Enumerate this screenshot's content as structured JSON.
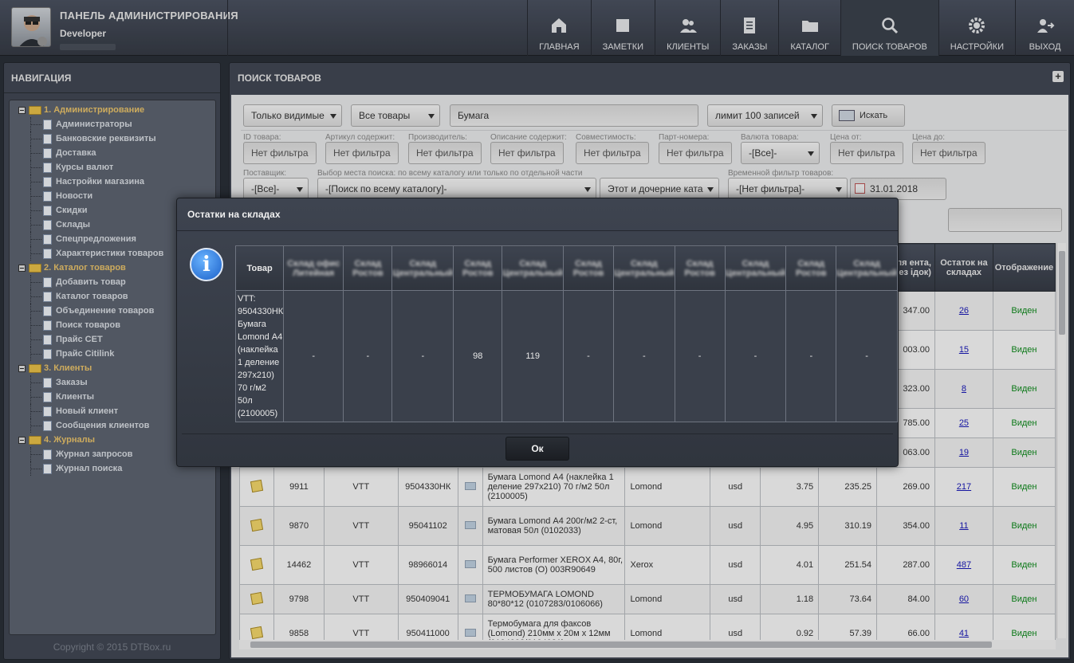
{
  "header": {
    "title": "ПАНЕЛЬ АДМИНИСТРИРОВАНИЯ",
    "user": "Developer",
    "nav": [
      {
        "label": "ГЛАВНАЯ",
        "icon": "home-icon"
      },
      {
        "label": "ЗАМЕТКИ",
        "icon": "notes-icon"
      },
      {
        "label": "КЛИЕНТЫ",
        "icon": "clients-icon"
      },
      {
        "label": "ЗАКАЗЫ",
        "icon": "orders-icon"
      },
      {
        "label": "КАТАЛОГ",
        "icon": "folder-icon"
      },
      {
        "label": "ПОИСК ТОВАРОВ",
        "icon": "search-icon"
      },
      {
        "label": "НАСТРОЙКИ",
        "icon": "gear-icon"
      },
      {
        "label": "ВЫХОД",
        "icon": "logout-icon"
      }
    ]
  },
  "sidebar": {
    "title": "НАВИГАЦИЯ",
    "copyright": "Copyright © 2015 DTBox.ru",
    "groups": [
      {
        "label": "1. Администрирование",
        "items": [
          "Администраторы",
          "Банковские реквизиты",
          "Доставка",
          "Курсы валют",
          "Настройки магазина",
          "Новости",
          "Скидки",
          "Склады",
          "Спецпредложения",
          "Характеристики товаров"
        ]
      },
      {
        "label": "2. Каталог товаров",
        "items": [
          "Добавить товар",
          "Каталог товаров",
          "Объединение товаров",
          "Поиск товаров",
          "Прайс CET",
          "Прайс Citilink"
        ]
      },
      {
        "label": "3. Клиенты",
        "items": [
          "Заказы",
          "Клиенты",
          "Новый клиент",
          "Сообщения клиентов"
        ]
      },
      {
        "label": "4. Журналы",
        "items": [
          "Журнал запросов",
          "Журнал поиска"
        ]
      }
    ]
  },
  "main": {
    "title": "ПОИСК ТОВАРОВ",
    "plus": "+",
    "visibility_select": "Только видимые",
    "scope_select": "Все товары",
    "query": "Бумага",
    "limit_select": "лимит 100 записей",
    "search_button": "Искать",
    "filters": [
      {
        "label": "ID товара:",
        "value": "Нет фильтра"
      },
      {
        "label": "Артикул содержит:",
        "value": "Нет фильтра"
      },
      {
        "label": "Производитель:",
        "value": "Нет фильтра"
      },
      {
        "label": "Описание содержит:",
        "value": "Нет фильтра"
      },
      {
        "label": "Совместимость:",
        "value": "Нет фильтра"
      },
      {
        "label": "Парт-номера:",
        "value": "Нет фильтра"
      },
      {
        "label": "Валюта товара:",
        "value": "-[Все]-"
      },
      {
        "label": "Цена от:",
        "value": "Нет фильтра"
      },
      {
        "label": "Цена до:",
        "value": "Нет фильтра"
      }
    ],
    "supplier_label": "Поставщик:",
    "supplier_value": "-[Все]-",
    "place_label": "Выбор места поиска: по всему каталогу или только по отдельной части",
    "place_value": "-[Поиск по всему каталогу]-",
    "children_value": "Этот и дочерние ката",
    "time_label": "Временной фильтр товаров:",
    "time_value": "-[Нет фильтра]-",
    "date_value": "31.01.2018",
    "columns": {
      "price_client": "на для ента, б (без ідок)",
      "stock": "Остаток на складах",
      "display": "Отображение"
    },
    "rows": [
      {
        "id": "",
        "supplier": "",
        "article": "",
        "name": "",
        "maker": "",
        "cur": "",
        "p1": "",
        "p2": "",
        "p3": "347.00",
        "stock": "26",
        "display": "Виден"
      },
      {
        "id": "",
        "supplier": "",
        "article": "",
        "name": "",
        "maker": "",
        "cur": "",
        "p1": "",
        "p2": "",
        "p3": "003.00",
        "stock": "15",
        "display": "Виден"
      },
      {
        "id": "",
        "supplier": "",
        "article": "",
        "name": "",
        "maker": "",
        "cur": "",
        "p1": "",
        "p2": "",
        "p3": "323.00",
        "stock": "8",
        "display": "Виден"
      },
      {
        "id": "",
        "supplier": "",
        "article": "",
        "name": "",
        "maker": "",
        "cur": "",
        "p1": "",
        "p2": "",
        "p3": "785.00",
        "stock": "25",
        "display": "Виден"
      },
      {
        "id": "",
        "supplier": "",
        "article": "",
        "name": "",
        "maker": "",
        "cur": "",
        "p1": "",
        "p2": "",
        "p3": "063.00",
        "stock": "19",
        "display": "Виден"
      },
      {
        "id": "9911",
        "supplier": "VTT",
        "article": "9504330НК",
        "name": "Бумага Lomond А4 (наклейка 1 деление 297x210) 70 г/м2 50л (2100005)",
        "maker": "Lomond",
        "cur": "usd",
        "p1": "3.75",
        "p2": "235.25",
        "p3": "269.00",
        "stock": "217",
        "display": "Виден"
      },
      {
        "id": "9870",
        "supplier": "VTT",
        "article": "95041102",
        "name": "Бумага Lomond А4 200г/м2 2-ст, матовая 50л (0102033)",
        "maker": "Lomond",
        "cur": "usd",
        "p1": "4.95",
        "p2": "310.19",
        "p3": "354.00",
        "stock": "11",
        "display": "Виден"
      },
      {
        "id": "14462",
        "supplier": "VTT",
        "article": "98966014",
        "name": "Бумага Performer XEROX A4, 80г, 500 листов (О) 003R90649",
        "maker": "Xerox",
        "cur": "usd",
        "p1": "4.01",
        "p2": "251.54",
        "p3": "287.00",
        "stock": "487",
        "display": "Виден"
      },
      {
        "id": "9798",
        "supplier": "VTT",
        "article": "950409041",
        "name": "ТЕРМОБУМАГА LOMOND 80*80*12 (0107283/0106066)",
        "maker": "Lomond",
        "cur": "usd",
        "p1": "1.18",
        "p2": "73.64",
        "p3": "84.00",
        "stock": "60",
        "display": "Виден"
      },
      {
        "id": "9858",
        "supplier": "VTT",
        "article": "950411000",
        "name": "Термобумага для факсов (Lomond) 210мм х 20м х 12мм (0104008/0104031)",
        "maker": "Lomond",
        "cur": "usd",
        "p1": "0.92",
        "p2": "57.39",
        "p3": "66.00",
        "stock": "41",
        "display": "Виден"
      }
    ]
  },
  "modal": {
    "title": "Остатки на складах",
    "product_header": "Товар",
    "product": "VTT: 9504330НК Бумага Lomond А4 (наклейка 1 деление 297x210) 70 г/м2 50л (2100005)",
    "warehouses": [
      {
        "name": "Склад офис Литейная",
        "value": "-"
      },
      {
        "name": "Склад Ростов",
        "value": "-"
      },
      {
        "name": "Склад Центральный",
        "value": "-"
      },
      {
        "name": "Склад Ростов",
        "value": "98"
      },
      {
        "name": "Склад Центральный",
        "value": "119"
      },
      {
        "name": "Склад Ростов",
        "value": "-"
      },
      {
        "name": "Склад Центральный",
        "value": "-"
      },
      {
        "name": "Склад Ростов",
        "value": "-"
      },
      {
        "name": "Склад Центральный",
        "value": "-"
      },
      {
        "name": "Склад Ростов",
        "value": "-"
      },
      {
        "name": "Склад Центральный",
        "value": "-"
      }
    ],
    "ok": "Ок"
  }
}
